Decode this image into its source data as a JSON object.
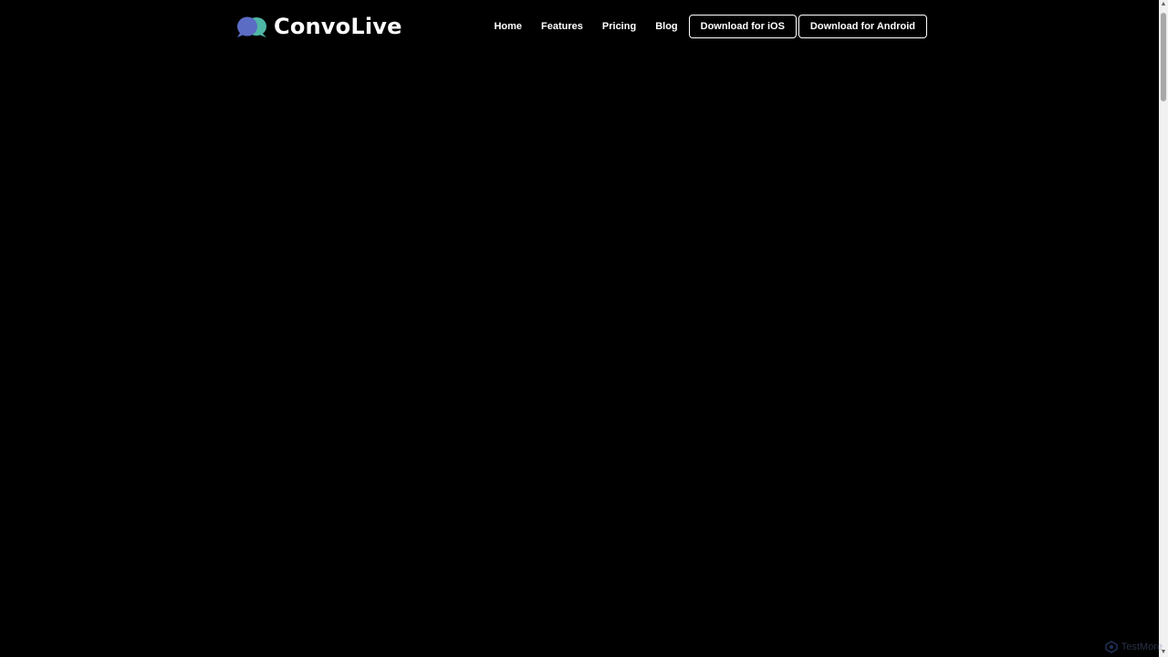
{
  "brand": {
    "name": "ConvoLive",
    "logo_icon": "chat-bubbles-icon",
    "logo_colors": [
      "#5b6cc4",
      "#4fb7a6"
    ]
  },
  "nav": {
    "links": [
      {
        "label": "Home"
      },
      {
        "label": "Features"
      },
      {
        "label": "Pricing"
      },
      {
        "label": "Blog"
      }
    ],
    "ios_button_label": "Download for iOS",
    "android_button_label": "Download for Android"
  },
  "watermark": {
    "text": "TestMore",
    "icon": "watermark-logo-icon"
  },
  "colors": {
    "background": "#000000",
    "text": "#ffffff",
    "button_border": "#ffffff"
  }
}
